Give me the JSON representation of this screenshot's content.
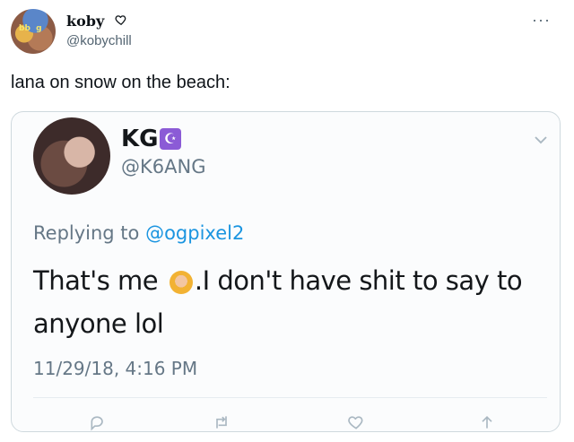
{
  "tweet": {
    "display_name": "koby",
    "handle": "@kobychill",
    "text": "lana on snow on the beach:",
    "more_icon": "more-dots-icon",
    "name_badge_icon": "heart-outline-icon"
  },
  "quoted_tweet": {
    "display_name": "KG",
    "badge_symbol": "☪",
    "badge_icon": "crescent-icon",
    "handle": "@K6ANG",
    "replying_prefix": "Replying to ",
    "replying_to": "@ogpixel2",
    "body_before_emoji": "That's me ",
    "emoji_icon": "person-tipping-hand-emoji",
    "body_after_emoji": ".I don't have shit to say to anyone lol",
    "timestamp": "11/29/18, 4:16 PM",
    "actions": [
      "reply-icon",
      "retweet-icon",
      "like-icon",
      "share-icon"
    ],
    "colors": {
      "mention": "#1b95e0",
      "badge": "#8b5bd6"
    }
  }
}
